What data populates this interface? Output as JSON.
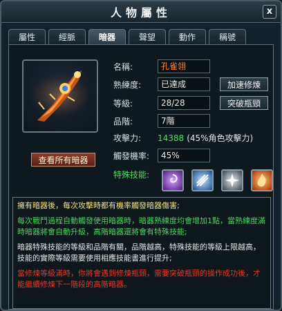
{
  "window": {
    "title": "人物屬性",
    "close_label": "x"
  },
  "tabs": [
    {
      "label": "屬性"
    },
    {
      "label": "經脈"
    },
    {
      "label": "暗器",
      "active": true
    },
    {
      "label": "聲望"
    },
    {
      "label": "動作"
    },
    {
      "label": "稱號"
    }
  ],
  "hidden_weapon": {
    "view_all_label": "查看所有暗器",
    "name_label": "名稱:",
    "name_value": "孔雀翎",
    "proficiency_label": "熟練度:",
    "proficiency_value": "已達成",
    "practice_button": "加速修煉",
    "level_label": "等級:",
    "level_value": "28/28",
    "breakthrough_button": "突破瓶頸",
    "grade_label": "品階:",
    "grade_value": "7階",
    "attack_label": "攻擊力:",
    "attack_value": "14388",
    "attack_extra": "(45%角色攻擊力)",
    "trigger_label": "觸發機率:",
    "trigger_value": "45%",
    "skills_label": "特殊技能:",
    "skills": [
      {
        "icon": "purple-vortex-icon"
      },
      {
        "icon": "ice-shard-icon"
      },
      {
        "icon": "silver-burst-icon"
      },
      {
        "icon": "fire-phoenix-icon"
      }
    ]
  },
  "description": {
    "line1": "擁有暗器後，每次攻擊時都有機率觸發暗器傷害;",
    "line2": "每次戰鬥過程自動觸發使用暗器時，暗器熟練度均會增加1點，當熟練度滿時暗器將會自動升級，高階暗器還將會有特殊技能;",
    "line3": "暗器特殊技能的等級和品階有關，品階越高，特殊技能的等級上限越高，技能的實際等級需要使用相應技能書進行提升;",
    "line4": "當修煉等級滿時，你將會遇到修煉瓶頸，需要突破瓶頸的操作成功後，才能繼續修煉下一階段的高階暗器。"
  }
}
